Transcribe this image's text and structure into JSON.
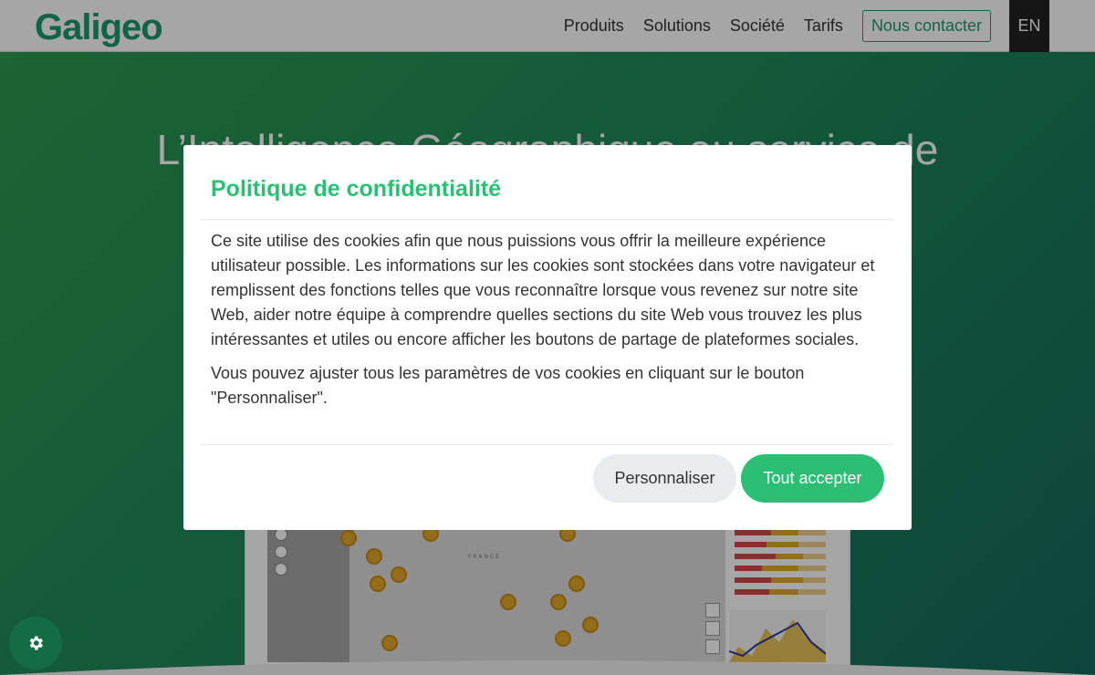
{
  "header": {
    "logo": "Galigeo",
    "nav": [
      "Produits",
      "Solutions",
      "Société",
      "Tarifs"
    ],
    "contact_label": "Nous contacter",
    "lang_label": "EN"
  },
  "hero": {
    "title": "L’Intelligence Géographique au service de"
  },
  "map": {
    "country_label": "FRANCE"
  },
  "cookie_modal": {
    "title": "Politique de confidentialité",
    "paragraph1": "Ce site utilise des cookies afin que nous puissions vous offrir la meilleure expérience utilisateur possible. Les informations sur les cookies sont stockées dans votre navigateur et remplissent des fonctions telles que vous reconnaître lorsque vous revenez sur notre site Web, aider notre équipe à comprendre quelles sections du site Web vous trouvez les plus intéressantes et utiles ou encore afficher les boutons de partage de plateformes sociales.",
    "paragraph2": "Vous pouvez ajuster tous les paramètres de vos cookies en cliquant sur le bouton \"Personnaliser\".",
    "customize_label": "Personnaliser",
    "accept_label": "Tout accepter"
  },
  "colors": {
    "brand": "#1a9a6e",
    "accent": "#2bbf76"
  },
  "icons": {
    "settings": "gear-icon"
  }
}
